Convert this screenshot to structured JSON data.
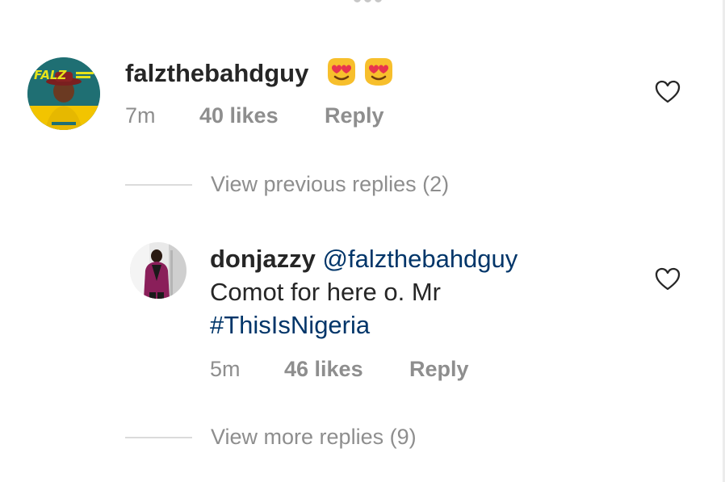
{
  "comment": {
    "username": "falzthebahdguy",
    "emojis": [
      "heart-eyes-emoji",
      "heart-eyes-emoji"
    ],
    "time": "7m",
    "likes": "40 likes",
    "reply_label": "Reply",
    "avatar_text": "FALZ"
  },
  "view_previous": "View previous replies (2)",
  "reply": {
    "username": "donjazzy",
    "mention": "@falzthebahdguy",
    "text": "Comot for here o. Mr",
    "hashtag": "#ThisIsNigeria",
    "time": "5m",
    "likes": "46 likes",
    "reply_label": "Reply"
  },
  "view_more": "View more replies (9)",
  "colors": {
    "text": "#262626",
    "muted": "#8e8e8e",
    "link": "#003569",
    "divider": "#dbdbdb"
  },
  "icons": {
    "like": "heart-outline-icon"
  }
}
